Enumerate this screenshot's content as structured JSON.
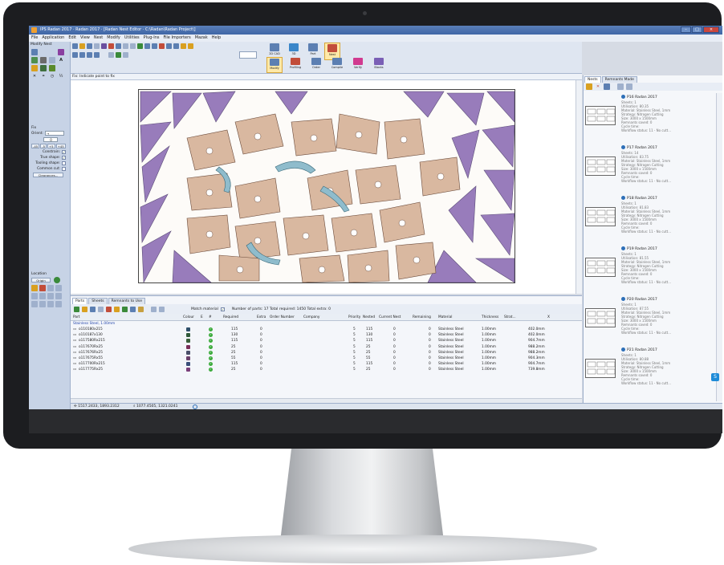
{
  "window": {
    "title": "IPS Radan 2017 · Radan 2017 · [Radan Nest Editor · C:\\Radan\\Radan Project\\]"
  },
  "menu": [
    "File",
    "Application",
    "Edit",
    "View",
    "Nest",
    "Modify",
    "Utilities",
    "Plug-Ins",
    "File Importers",
    "Mazak",
    "Help"
  ],
  "left_panel": {
    "title": "Modify Nest",
    "fix_label": "Fix",
    "orient_label": "Orient:",
    "orient_value": "→",
    "angle_value": "0",
    "angle_buttons": [
      "-45",
      "-5",
      "+5",
      "+45"
    ],
    "checks": [
      {
        "label": "Constrain:",
        "checked": true
      },
      {
        "label": "True shape:",
        "checked": true
      },
      {
        "label": "Tooling shape:",
        "checked": false
      },
      {
        "label": "Common cut:",
        "checked": false
      }
    ],
    "clearances_button": "Clearances...",
    "location_label": "Location",
    "origin_button": "Origin"
  },
  "ribbon": {
    "big_buttons": [
      {
        "label": "2D CAD",
        "color": "#5c7fb2"
      },
      {
        "label": "3D",
        "color": "#3a86c9"
      },
      {
        "label": "Part",
        "color": "#5c7fb2"
      },
      {
        "label": "Nest",
        "color": "#c24d3a",
        "active": true
      }
    ],
    "mode_buttons": [
      {
        "label": "Modify",
        "color": "#5c7fb2",
        "active": true
      },
      {
        "label": "Profiling",
        "color": "#c24d3a"
      },
      {
        "label": "Order",
        "color": "#5c7fb2"
      },
      {
        "label": "Compile",
        "color": "#5c7fb2"
      },
      {
        "label": "Verify",
        "color": "#d13a8f"
      },
      {
        "label": "Blocks",
        "color": "#7a5fb5"
      }
    ]
  },
  "hint": "Fix: Indicate point to fix",
  "parts_tabs": [
    "Parts",
    "Sheets",
    "Remnants to Use"
  ],
  "parts_toolbar": {
    "match_material_label": "Match material",
    "match_material_checked": true,
    "summary": "Number of parts: 17   Total required: 1450   Total extra: 0"
  },
  "table": {
    "headers": [
      "Part",
      "Colour",
      "E",
      "#",
      "Required",
      "Extra",
      "Order Number",
      "Company",
      "Priority",
      "Nested",
      "Current Nest",
      "Remaining",
      "Material",
      "Thickness",
      "Strat...",
      "X"
    ],
    "group": "Stainless Steel, 1.00mm",
    "rows": [
      {
        "part": "o110180x215",
        "colour": "#2f4f6a",
        "required": "115",
        "extra": "0",
        "priority": "5",
        "nested": "115",
        "current": "0",
        "remaining": "0",
        "material": "Stainless Steel",
        "thickness": "1.00mm",
        "x": "402.0mm"
      },
      {
        "part": "o110187x130",
        "colour": "#2f5a3a",
        "required": "130",
        "extra": "0",
        "priority": "5",
        "nested": "130",
        "current": "0",
        "remaining": "0",
        "material": "Stainless Steel",
        "thickness": "1.00mm",
        "x": "402.0mm"
      },
      {
        "part": "o117580Rx215",
        "colour": "#3a5f3a",
        "required": "115",
        "extra": "0",
        "priority": "5",
        "nested": "115",
        "current": "0",
        "remaining": "0",
        "material": "Stainless Steel",
        "thickness": "1.00mm",
        "x": "904.7mm"
      },
      {
        "part": "o117670Rx25",
        "colour": "#7a2f5a",
        "required": "25",
        "extra": "0",
        "priority": "5",
        "nested": "25",
        "current": "0",
        "remaining": "0",
        "material": "Stainless Steel",
        "thickness": "1.00mm",
        "x": "988.2mm"
      },
      {
        "part": "o117676Rx25",
        "colour": "#4a4f6a",
        "required": "25",
        "extra": "0",
        "priority": "5",
        "nested": "25",
        "current": "0",
        "remaining": "0",
        "material": "Stainless Steel",
        "thickness": "1.00mm",
        "x": "988.2mm"
      },
      {
        "part": "o117675Rx55",
        "colour": "#6a3f6a",
        "required": "55",
        "extra": "0",
        "priority": "5",
        "nested": "55",
        "current": "0",
        "remaining": "0",
        "material": "Stainless Steel",
        "thickness": "1.00mm",
        "x": "904.3mm"
      },
      {
        "part": "o117700Rx215",
        "colour": "#3a4f7a",
        "required": "115",
        "extra": "0",
        "priority": "5",
        "nested": "115",
        "current": "0",
        "remaining": "0",
        "material": "Stainless Steel",
        "thickness": "1.00mm",
        "x": "904.7mm"
      },
      {
        "part": "o117775Rx25",
        "colour": "#7a3f7a",
        "required": "25",
        "extra": "0",
        "priority": "5",
        "nested": "25",
        "current": "0",
        "remaining": "0",
        "material": "Stainless Steel",
        "thickness": "1.00mm",
        "x": "739.8mm"
      }
    ]
  },
  "status": {
    "coord1": "1517.2433, 1893.2312",
    "coord2": "1077.4505, 1321.0241"
  },
  "right_panel": {
    "tabs": [
      "Nests",
      "Remnants Made"
    ],
    "nests": [
      {
        "title": "P16 Radan 2017",
        "sheets": "Sheets: 1",
        "utilisation": "Utilisation: 80.35",
        "material": "Material: Stainless Steel, 1mm",
        "strategy": "Strategy: Nitrogen Cutting",
        "size": "Size: 3000 x 1500mm",
        "remnants": "Remnants saved: 0",
        "cycle": "Cycle time:",
        "workflow": "Workflow status: 11 - No cutt..."
      },
      {
        "title": "P17 Radan 2017",
        "sheets": "Sheets: 14",
        "utilisation": "Utilisation: 83.75",
        "material": "Material: Stainless Steel, 1mm",
        "strategy": "Strategy: Nitrogen Cutting",
        "size": "Size: 3000 x 1500mm",
        "remnants": "Remnants saved: 0",
        "cycle": "Cycle time:",
        "workflow": "Workflow status: 11 - No cutt..."
      },
      {
        "title": "P18 Radan 2017",
        "sheets": "Sheets: 1",
        "utilisation": "Utilisation: 81.83",
        "material": "Material: Stainless Steel, 1mm",
        "strategy": "Strategy: Nitrogen Cutting",
        "size": "Size: 3000 x 1500mm",
        "remnants": "Remnants saved: 0",
        "cycle": "Cycle time:",
        "workflow": "Workflow status: 11 - No cutt..."
      },
      {
        "title": "P19 Radan 2017",
        "sheets": "Sheets: 1",
        "utilisation": "Utilisation: 81.55",
        "material": "Material: Stainless Steel, 1mm",
        "strategy": "Strategy: Nitrogen Cutting",
        "size": "Size: 3000 x 1500mm",
        "remnants": "Remnants saved: 0",
        "cycle": "Cycle time:",
        "workflow": "Workflow status: 11 - No cutt..."
      },
      {
        "title": "P20 Radan 2017",
        "sheets": "Sheets: 1",
        "utilisation": "Utilisation: 87.55",
        "material": "Material: Stainless Steel, 1mm",
        "strategy": "Strategy: Nitrogen Cutting",
        "size": "Size: 3000 x 1500mm",
        "remnants": "Remnants saved: 0",
        "cycle": "Cycle time:",
        "workflow": "Workflow status: 11 - No cutt..."
      },
      {
        "title": "P21 Radan 2017",
        "sheets": "Sheets: 1",
        "utilisation": "Utilisation: 80.88",
        "material": "Material: Stainless Steel, 1mm",
        "strategy": "Strategy: Nitrogen Cutting",
        "size": "Size: 3000 x 1500mm",
        "remnants": "Remnants saved: 0",
        "cycle": "Cycle time:",
        "workflow": "Workflow status: 11 - No cutt..."
      }
    ]
  },
  "colors": {
    "purple_part": "#8e6fb5",
    "tan_part": "#d9b8a0",
    "teal_part": "#8fbccc",
    "accent": "#3f66a6"
  }
}
